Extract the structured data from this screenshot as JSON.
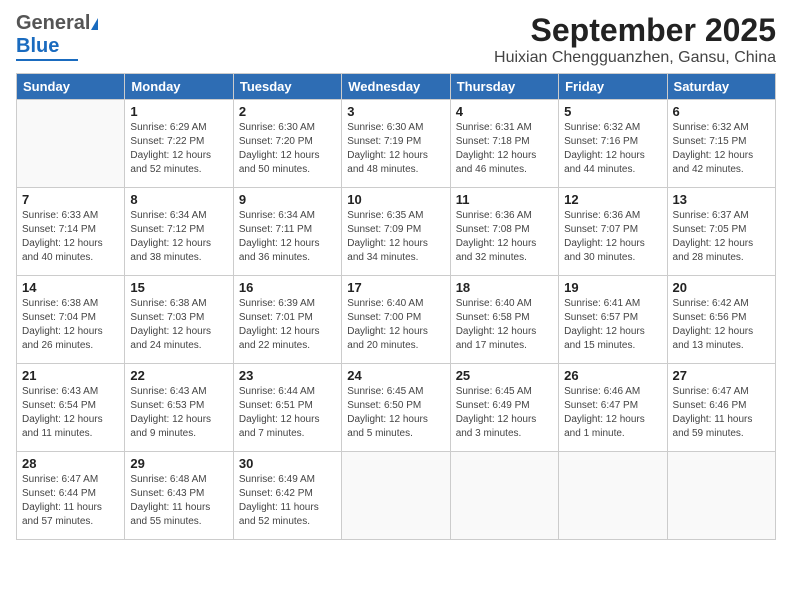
{
  "header": {
    "logo_general": "General",
    "logo_blue": "Blue",
    "month": "September 2025",
    "location": "Huixian Chengguanzhen, Gansu, China"
  },
  "weekdays": [
    "Sunday",
    "Monday",
    "Tuesday",
    "Wednesday",
    "Thursday",
    "Friday",
    "Saturday"
  ],
  "weeks": [
    [
      {
        "day": "",
        "info": ""
      },
      {
        "day": "1",
        "info": "Sunrise: 6:29 AM\nSunset: 7:22 PM\nDaylight: 12 hours\nand 52 minutes."
      },
      {
        "day": "2",
        "info": "Sunrise: 6:30 AM\nSunset: 7:20 PM\nDaylight: 12 hours\nand 50 minutes."
      },
      {
        "day": "3",
        "info": "Sunrise: 6:30 AM\nSunset: 7:19 PM\nDaylight: 12 hours\nand 48 minutes."
      },
      {
        "day": "4",
        "info": "Sunrise: 6:31 AM\nSunset: 7:18 PM\nDaylight: 12 hours\nand 46 minutes."
      },
      {
        "day": "5",
        "info": "Sunrise: 6:32 AM\nSunset: 7:16 PM\nDaylight: 12 hours\nand 44 minutes."
      },
      {
        "day": "6",
        "info": "Sunrise: 6:32 AM\nSunset: 7:15 PM\nDaylight: 12 hours\nand 42 minutes."
      }
    ],
    [
      {
        "day": "7",
        "info": "Sunrise: 6:33 AM\nSunset: 7:14 PM\nDaylight: 12 hours\nand 40 minutes."
      },
      {
        "day": "8",
        "info": "Sunrise: 6:34 AM\nSunset: 7:12 PM\nDaylight: 12 hours\nand 38 minutes."
      },
      {
        "day": "9",
        "info": "Sunrise: 6:34 AM\nSunset: 7:11 PM\nDaylight: 12 hours\nand 36 minutes."
      },
      {
        "day": "10",
        "info": "Sunrise: 6:35 AM\nSunset: 7:09 PM\nDaylight: 12 hours\nand 34 minutes."
      },
      {
        "day": "11",
        "info": "Sunrise: 6:36 AM\nSunset: 7:08 PM\nDaylight: 12 hours\nand 32 minutes."
      },
      {
        "day": "12",
        "info": "Sunrise: 6:36 AM\nSunset: 7:07 PM\nDaylight: 12 hours\nand 30 minutes."
      },
      {
        "day": "13",
        "info": "Sunrise: 6:37 AM\nSunset: 7:05 PM\nDaylight: 12 hours\nand 28 minutes."
      }
    ],
    [
      {
        "day": "14",
        "info": "Sunrise: 6:38 AM\nSunset: 7:04 PM\nDaylight: 12 hours\nand 26 minutes."
      },
      {
        "day": "15",
        "info": "Sunrise: 6:38 AM\nSunset: 7:03 PM\nDaylight: 12 hours\nand 24 minutes."
      },
      {
        "day": "16",
        "info": "Sunrise: 6:39 AM\nSunset: 7:01 PM\nDaylight: 12 hours\nand 22 minutes."
      },
      {
        "day": "17",
        "info": "Sunrise: 6:40 AM\nSunset: 7:00 PM\nDaylight: 12 hours\nand 20 minutes."
      },
      {
        "day": "18",
        "info": "Sunrise: 6:40 AM\nSunset: 6:58 PM\nDaylight: 12 hours\nand 17 minutes."
      },
      {
        "day": "19",
        "info": "Sunrise: 6:41 AM\nSunset: 6:57 PM\nDaylight: 12 hours\nand 15 minutes."
      },
      {
        "day": "20",
        "info": "Sunrise: 6:42 AM\nSunset: 6:56 PM\nDaylight: 12 hours\nand 13 minutes."
      }
    ],
    [
      {
        "day": "21",
        "info": "Sunrise: 6:43 AM\nSunset: 6:54 PM\nDaylight: 12 hours\nand 11 minutes."
      },
      {
        "day": "22",
        "info": "Sunrise: 6:43 AM\nSunset: 6:53 PM\nDaylight: 12 hours\nand 9 minutes."
      },
      {
        "day": "23",
        "info": "Sunrise: 6:44 AM\nSunset: 6:51 PM\nDaylight: 12 hours\nand 7 minutes."
      },
      {
        "day": "24",
        "info": "Sunrise: 6:45 AM\nSunset: 6:50 PM\nDaylight: 12 hours\nand 5 minutes."
      },
      {
        "day": "25",
        "info": "Sunrise: 6:45 AM\nSunset: 6:49 PM\nDaylight: 12 hours\nand 3 minutes."
      },
      {
        "day": "26",
        "info": "Sunrise: 6:46 AM\nSunset: 6:47 PM\nDaylight: 12 hours\nand 1 minute."
      },
      {
        "day": "27",
        "info": "Sunrise: 6:47 AM\nSunset: 6:46 PM\nDaylight: 11 hours\nand 59 minutes."
      }
    ],
    [
      {
        "day": "28",
        "info": "Sunrise: 6:47 AM\nSunset: 6:44 PM\nDaylight: 11 hours\nand 57 minutes."
      },
      {
        "day": "29",
        "info": "Sunrise: 6:48 AM\nSunset: 6:43 PM\nDaylight: 11 hours\nand 55 minutes."
      },
      {
        "day": "30",
        "info": "Sunrise: 6:49 AM\nSunset: 6:42 PM\nDaylight: 11 hours\nand 52 minutes."
      },
      {
        "day": "",
        "info": ""
      },
      {
        "day": "",
        "info": ""
      },
      {
        "day": "",
        "info": ""
      },
      {
        "day": "",
        "info": ""
      }
    ]
  ]
}
